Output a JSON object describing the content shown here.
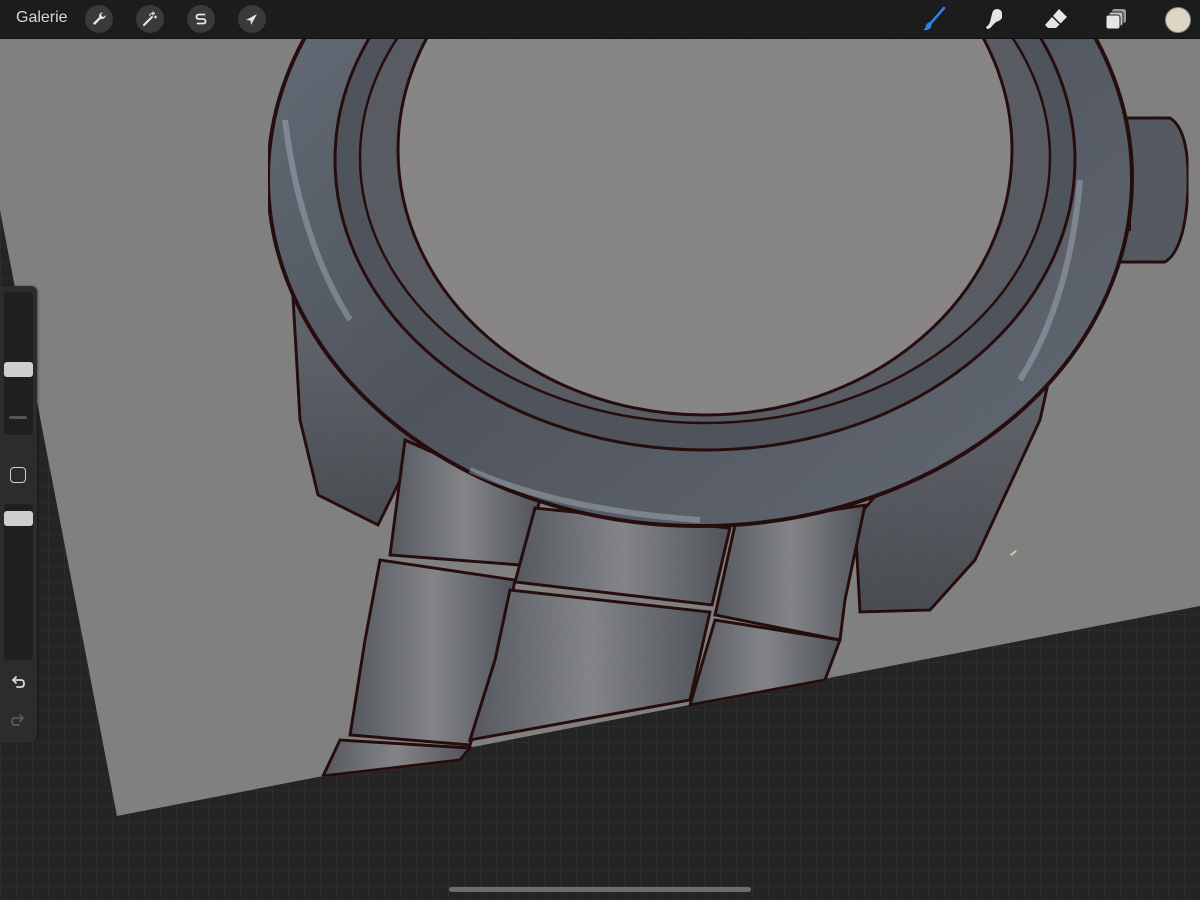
{
  "toolbar": {
    "gallery_label": "Galerie",
    "left_tools": [
      {
        "name": "actions",
        "icon": "wrench-icon"
      },
      {
        "name": "adjustments",
        "icon": "magic-wand-icon"
      },
      {
        "name": "selection",
        "icon": "selection-s-icon"
      },
      {
        "name": "transform",
        "icon": "arrow-cursor-icon"
      }
    ],
    "right_tools": [
      {
        "name": "brush",
        "icon": "brush-icon",
        "active": true
      },
      {
        "name": "smudge",
        "icon": "smudge-icon",
        "active": false
      },
      {
        "name": "eraser",
        "icon": "eraser-icon",
        "active": false
      },
      {
        "name": "layers",
        "icon": "layers-icon",
        "active": false
      }
    ],
    "current_color": "#dcd6c4"
  },
  "sidebar": {
    "brush_size_level": 0.45,
    "opacity_level": 0.95,
    "modify_button_icon": "square-icon",
    "undo_icon": "undo-icon",
    "redo_icon": "redo-icon"
  },
  "canvas": {
    "background_color": "#808080",
    "artwork": "watch-sketch",
    "accent_colors": {
      "bezel": "#5f6670",
      "outline": "#2a0d0d",
      "dial": "#8f8c8e",
      "active_tool": "#2f7ff0"
    }
  }
}
